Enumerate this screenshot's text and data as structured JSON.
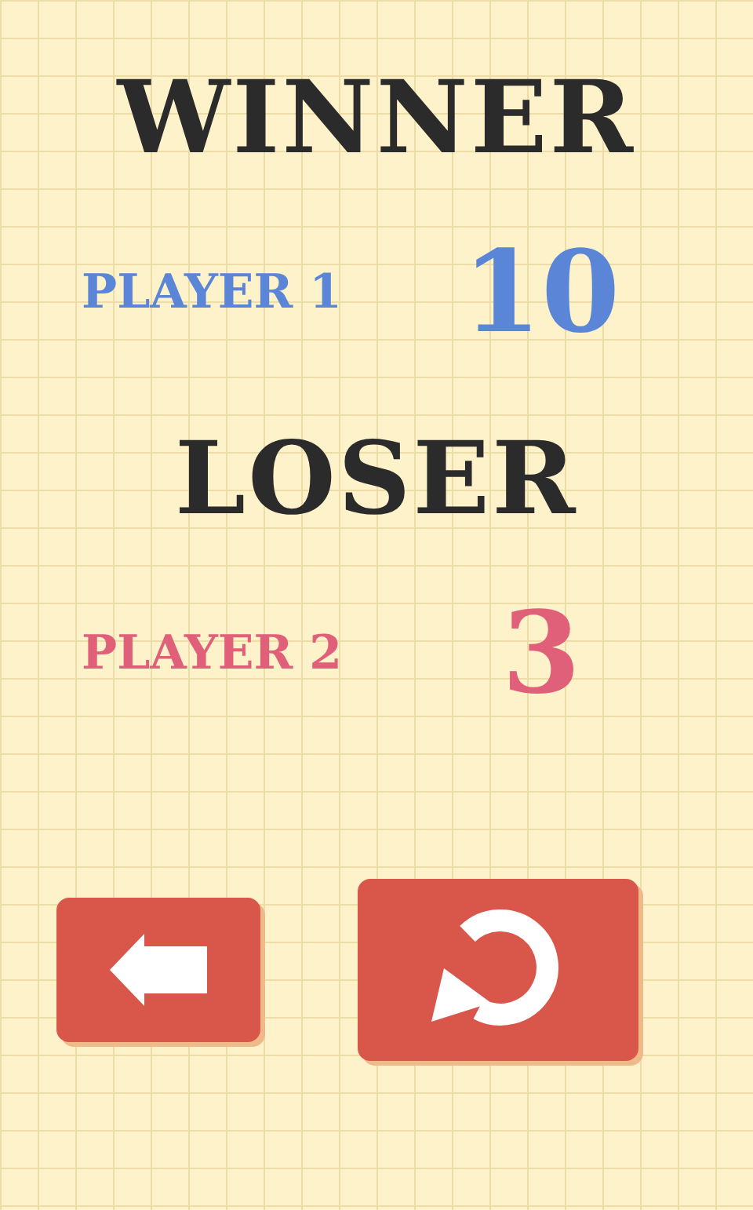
{
  "results": [
    {
      "heading": "WINNER",
      "player": "PLAYER 1",
      "score": "10",
      "color": "#5b86d8"
    },
    {
      "heading": "LOSER",
      "player": "PLAYER 2",
      "score": "3",
      "color": "#e0607a"
    }
  ],
  "buttons": [
    {
      "kind": "back"
    },
    {
      "kind": "replay"
    }
  ]
}
